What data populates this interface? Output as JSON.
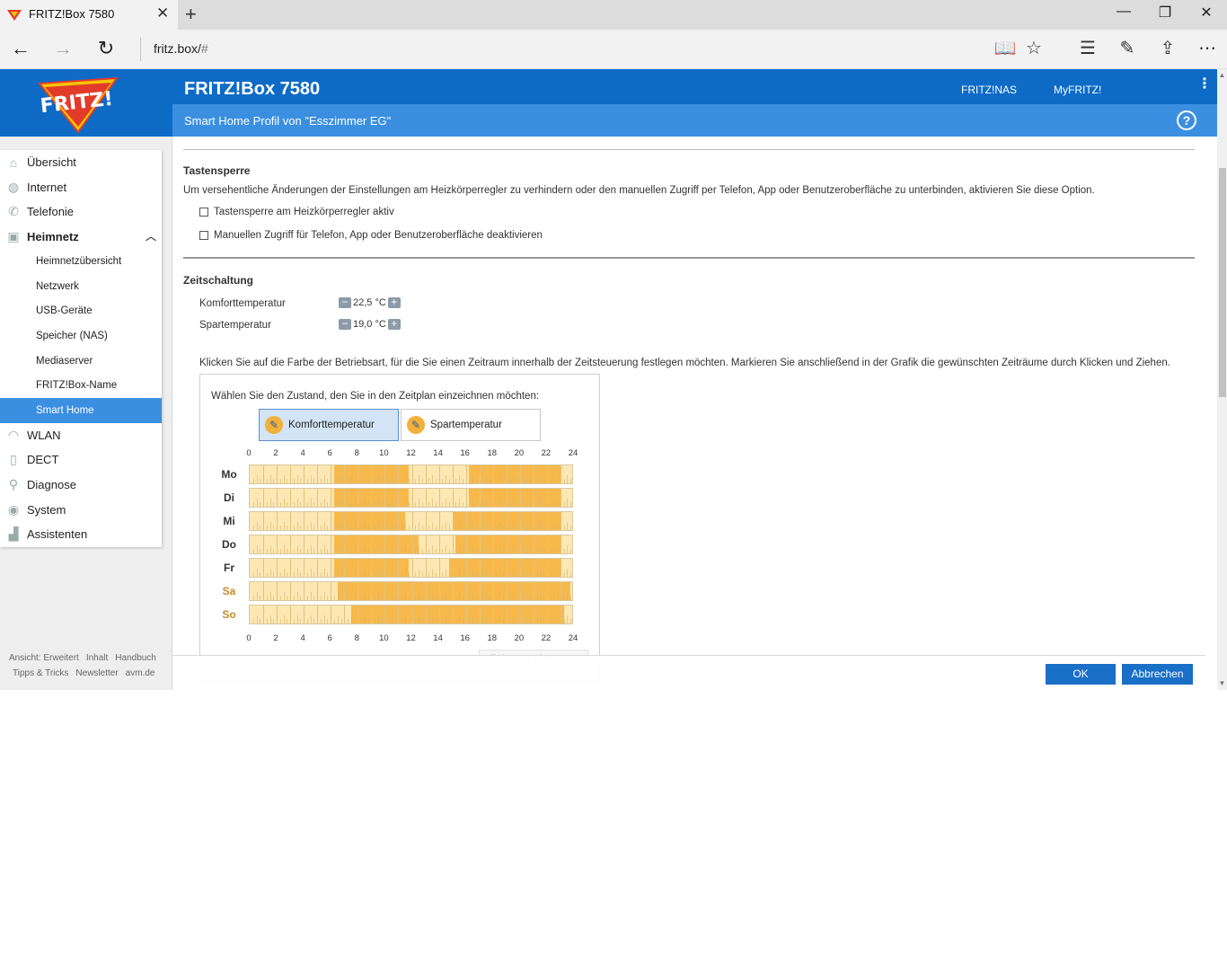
{
  "browser": {
    "tab_title": "FRITZ!Box 7580",
    "url_host": "fritz.box/",
    "url_hash": "#",
    "new_tab": "+",
    "close_tab": "✕",
    "back": "←",
    "forward": "→",
    "refresh": "↻",
    "minimize": "—",
    "restore": "❐",
    "close_window": "✕",
    "reading_view": "📖",
    "favorite": "☆",
    "hub": "☰",
    "notes": "✎",
    "share": "⇪",
    "more": "⋯"
  },
  "header": {
    "device_name": "FRITZ!Box 7580",
    "link_nas": "FRITZ!NAS",
    "link_myfritz": "MyFRITZ!",
    "menu_glyph": "⋮",
    "page_title": "Smart Home Profil von \"Esszimmer EG\"",
    "help": "?",
    "brand_color": "#0d6bc6",
    "subheader_color": "#3b8fe0"
  },
  "sidebar": {
    "items": [
      {
        "label": "Übersicht",
        "icon": "home-icon",
        "glyph": "⌂"
      },
      {
        "label": "Internet",
        "icon": "globe-icon",
        "glyph": "◍"
      },
      {
        "label": "Telefonie",
        "icon": "phone-icon",
        "glyph": "✆"
      },
      {
        "label": "Heimnetz",
        "icon": "network-icon",
        "glyph": "▣",
        "chevron": "︿"
      }
    ],
    "subitems": [
      {
        "label": "Heimnetzübersicht"
      },
      {
        "label": "Netzwerk"
      },
      {
        "label": "USB-Geräte"
      },
      {
        "label": "Speicher (NAS)"
      },
      {
        "label": "Mediaserver"
      },
      {
        "label": "FRITZ!Box-Name"
      },
      {
        "label": "Smart Home"
      }
    ],
    "items2": [
      {
        "label": "WLAN",
        "icon": "wifi-icon",
        "glyph": "◠"
      },
      {
        "label": "DECT",
        "icon": "dect-icon",
        "glyph": "▯"
      },
      {
        "label": "Diagnose",
        "icon": "diagnose-icon",
        "glyph": "⚲"
      },
      {
        "label": "System",
        "icon": "system-icon",
        "glyph": "◉"
      },
      {
        "label": "Assistenten",
        "icon": "assistant-icon",
        "glyph": "▟"
      }
    ],
    "footer": {
      "l1": "Ansicht: Erweitert",
      "l2": "Inhalt",
      "l3": "Handbuch",
      "l4": "Tipps & Tricks",
      "l5": "Newsletter",
      "l6": "avm.de"
    }
  },
  "tastensperre": {
    "title": "Tastensperre",
    "description": "Um versehentliche Änderungen der Einstellungen am Heizkörperregler zu verhindern oder den manuellen Zugriff per Telefon, App oder Benutzeroberfläche zu unterbinden, aktivieren Sie diese Option.",
    "option1": "Tastensperre am Heizkörperregler aktiv",
    "option2": "Manuellen Zugriff für Telefon, App oder Benutzeroberfläche deaktivieren"
  },
  "zeitschaltung": {
    "title": "Zeitschaltung",
    "komfort_label": "Komforttemperatur",
    "komfort_value": "22,5 °C",
    "spar_label": "Spartemperatur",
    "spar_value": "19,0 °C",
    "minus": "−",
    "plus": "+",
    "instruction": "Klicken Sie auf die Farbe der Betriebsart, für die Sie einen Zeitraum innerhalb der Zeitsteuerung festlegen möchten. Markieren Sie anschließend in der Grafik die gewünschten Zeiträume durch Klicken und Ziehen.",
    "prompt": "Wählen Sie den Zustand, den Sie in den Zeitplan einzeichnen möchten:",
    "mode_komfort": "Komforttemperatur",
    "mode_spar": "Spartemperatur",
    "pencil": "✎",
    "hours": [
      "0",
      "2",
      "4",
      "6",
      "8",
      "10",
      "12",
      "14",
      "16",
      "18",
      "20",
      "22",
      "24"
    ],
    "days": [
      {
        "label": "Mo",
        "weekend": false,
        "komfort": [
          [
            6.25,
            11.75
          ],
          [
            16.25,
            23.0
          ]
        ]
      },
      {
        "label": "Di",
        "weekend": false,
        "komfort": [
          [
            6.25,
            11.75
          ],
          [
            16.25,
            23.0
          ]
        ]
      },
      {
        "label": "Mi",
        "weekend": false,
        "komfort": [
          [
            6.25,
            11.5
          ],
          [
            15.0,
            23.0
          ]
        ]
      },
      {
        "label": "Do",
        "weekend": false,
        "komfort": [
          [
            6.25,
            12.5
          ],
          [
            15.25,
            23.0
          ]
        ]
      },
      {
        "label": "Fr",
        "weekend": false,
        "komfort": [
          [
            6.25,
            11.75
          ],
          [
            14.75,
            23.0
          ]
        ]
      },
      {
        "label": "Sa",
        "weekend": true,
        "komfort": [
          [
            6.5,
            23.75
          ]
        ]
      },
      {
        "label": "So",
        "weekend": true,
        "komfort": [
          [
            7.5,
            23.25
          ]
        ]
      }
    ],
    "komfort_color": "#f7b94c",
    "spar_color": "#fde7b3",
    "add_button": "Zeitraum eintragen"
  },
  "actions": {
    "ok": "OK",
    "cancel": "Abbrechen"
  },
  "scrollbar": {
    "up": "▲",
    "down": "▼"
  }
}
